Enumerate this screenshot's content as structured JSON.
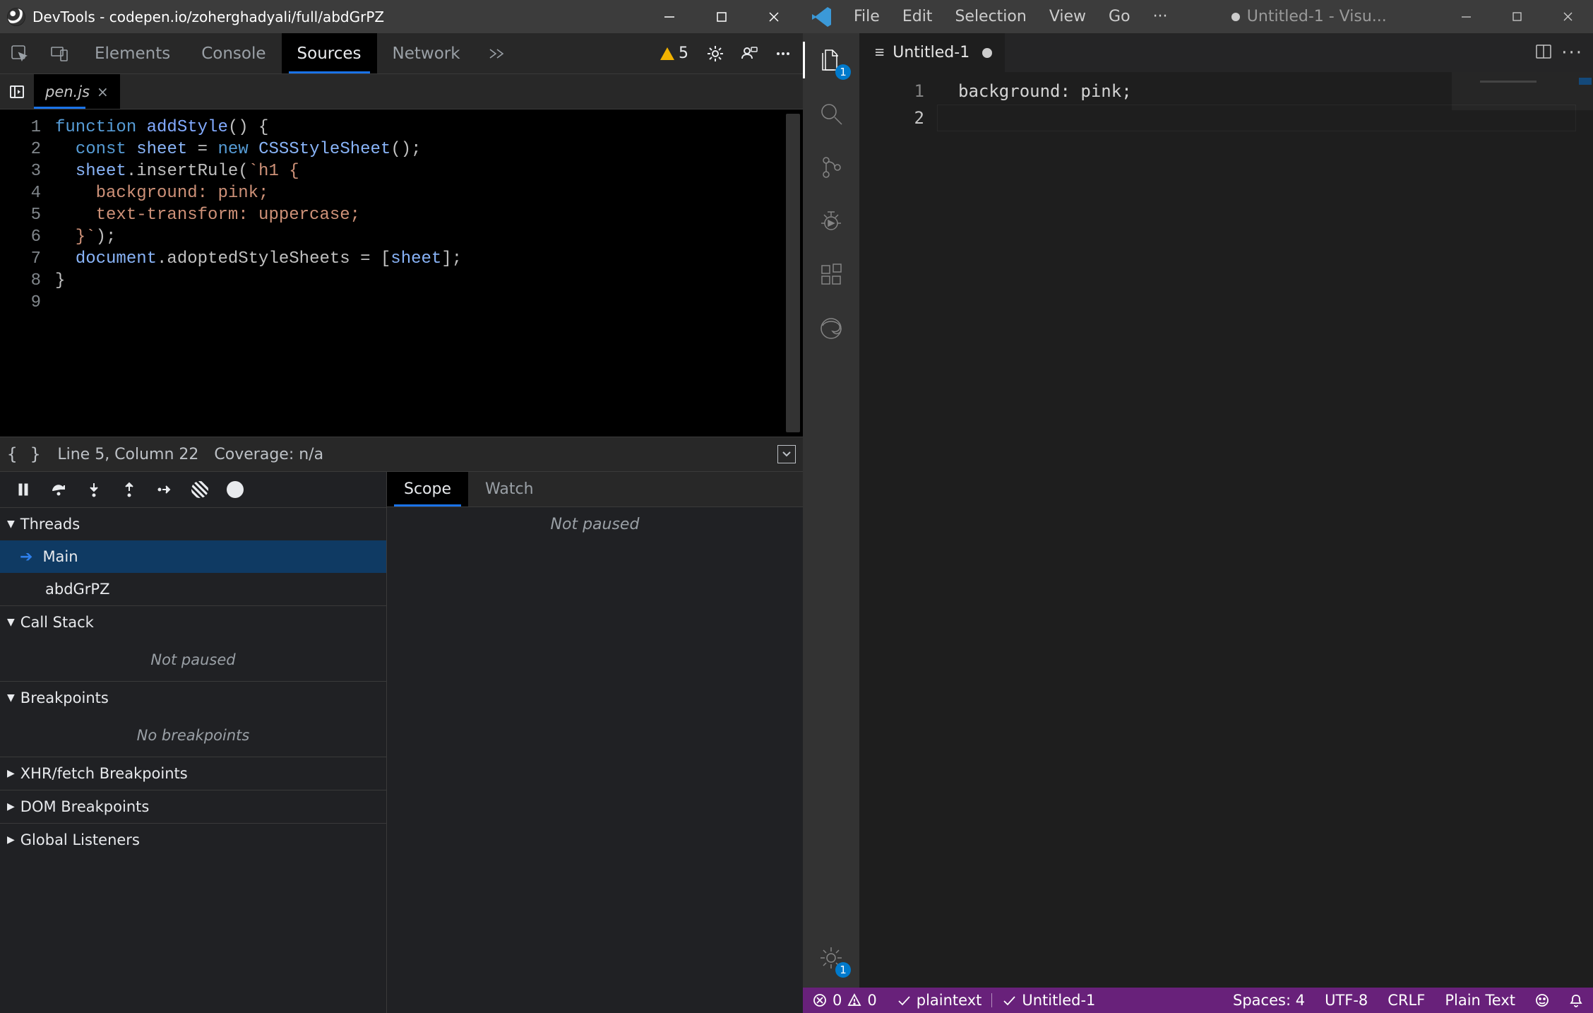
{
  "devtools": {
    "title": "DevTools - codepen.io/zoherghadyali/full/abdGrPZ",
    "tabs": {
      "elements": "Elements",
      "console": "Console",
      "sources": "Sources",
      "network": "Network"
    },
    "warn_count": "5",
    "file_tab": "pen.js",
    "gutter": [
      "1",
      "2",
      "3",
      "4",
      "5",
      "6",
      "7",
      "8",
      "9"
    ],
    "code": {
      "l2_kw": "function",
      "l2_fn": "addStyle",
      "l2_rest": "() {",
      "l3_kw": "const",
      "l3_id": "sheet",
      "l3_eq": " = ",
      "l3_new": "new",
      "l3_type": "CSSStyleSheet",
      "l3_rest": "();",
      "l4_a": "sheet",
      "l4_b": ".insertRule(",
      "l4_s": "`h1 {",
      "l5": "    background: pink;",
      "l6": "    text-transform: uppercase;",
      "l7_a": "  }`",
      "l7_b": ");",
      "l8_a": "document",
      "l8_b": ".adoptedStyleSheets = [",
      "l8_c": "sheet",
      "l8_d": "];",
      "l9": "}"
    },
    "status": {
      "pos": "Line 5, Column 22",
      "coverage": "Coverage: n/a"
    },
    "subtabs": {
      "scope": "Scope",
      "watch": "Watch"
    },
    "scope_msg": "Not paused",
    "threads": {
      "head": "Threads",
      "main": "Main",
      "second": "abdGrPZ"
    },
    "callstack": {
      "head": "Call Stack",
      "msg": "Not paused"
    },
    "breakpoints": {
      "head": "Breakpoints",
      "msg": "No breakpoints"
    },
    "xhr": "XHR/fetch Breakpoints",
    "dom": "DOM Breakpoints",
    "global": "Global Listeners"
  },
  "vscode": {
    "menus": {
      "file": "File",
      "edit": "Edit",
      "selection": "Selection",
      "view": "View",
      "go": "Go",
      "more": "···"
    },
    "title": "Untitled-1 - Visu...",
    "explorer_badge": "1",
    "manage_badge": "1",
    "tab_name": "Untitled-1",
    "gutter": [
      "1",
      "2"
    ],
    "line1": "background: pink;",
    "status": {
      "err": "0",
      "warn": "0",
      "lang": "plaintext",
      "file": "Untitled-1",
      "spaces": "Spaces: 4",
      "enc": "UTF-8",
      "eol": "CRLF",
      "mode": "Plain Text"
    }
  }
}
